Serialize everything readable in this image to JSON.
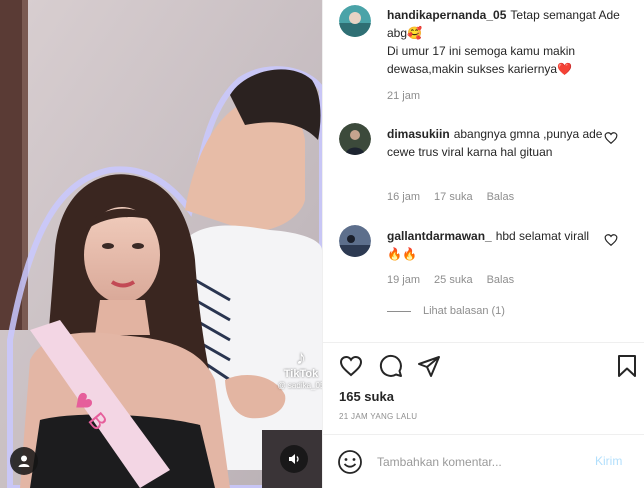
{
  "post": {
    "caption": {
      "username": "handikapernanda_05",
      "text": "Tetap semangat Ade abg🥰\nDi umur 17 ini semoga kamu makin dewasa,makin sukses kariernya❤️",
      "time": "21 jam"
    },
    "comments": [
      {
        "username": "dimasukiin",
        "text": "abangnya gmna ,punya ade cewe trus viral karna hal gituan",
        "time": "16 jam",
        "likes": "17 suka",
        "reply": "Balas"
      },
      {
        "username": "gallantdarmawan_",
        "text": "hbd selamat virall 🔥🔥",
        "time": "19 jam",
        "likes": "25 suka",
        "reply": "Balas",
        "view_replies": "Lihat balasan (1)"
      }
    ],
    "likes": "165 suka",
    "posted": "21 JAM YANG LALU"
  },
  "media": {
    "watermark_logo": "♪",
    "watermark_name": "TikTok",
    "watermark_user": "@ sadika_05"
  },
  "composer": {
    "placeholder": "Tambahkan komentar...",
    "post_label": "Kirim"
  },
  "icons": {
    "like": "heart-icon",
    "comment": "comment-icon",
    "share": "paper-plane-icon",
    "save": "bookmark-icon",
    "emoji": "smiley-icon",
    "user_tags": "user-icon",
    "mute": "speaker-icon"
  },
  "colors": {
    "text": "#262626",
    "muted": "#8e8e8e",
    "post_button": "#b2dffc",
    "heart_emoji": "#e8222f"
  }
}
